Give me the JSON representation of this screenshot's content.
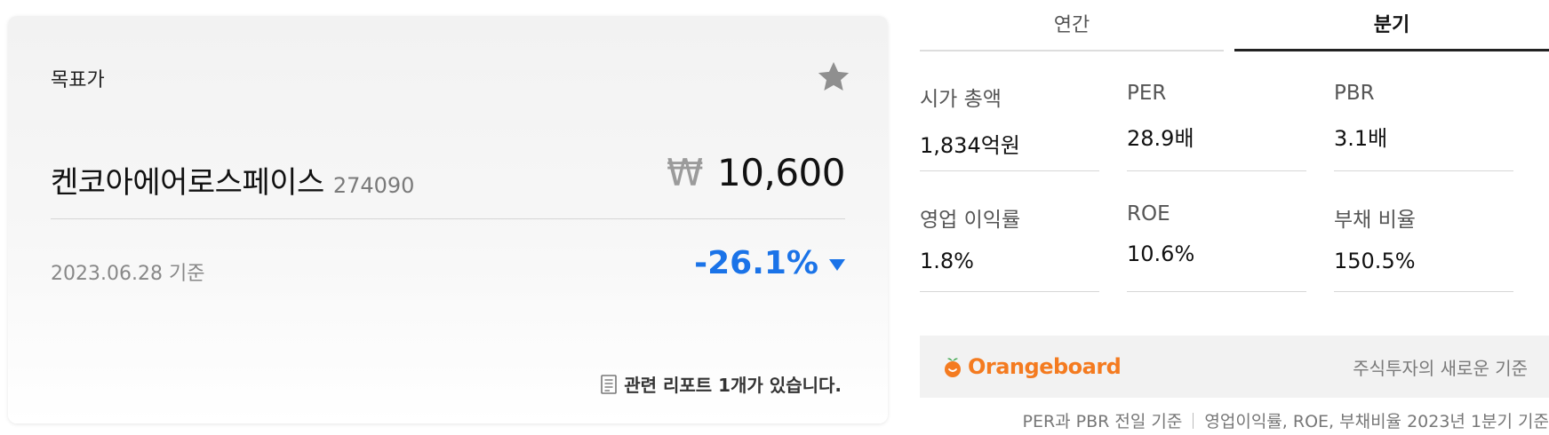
{
  "target_card": {
    "label": "목표가",
    "company_name": "켄코아에어로스페이스",
    "company_code": "274090",
    "currency_symbol": "₩",
    "target_price": "10,600",
    "as_of": "2023.06.28 기준",
    "change": "-26.1%",
    "change_color": "#1a73e8",
    "report_text": "관련 리포트 1개가 있습니다.",
    "icons": {
      "favorite": "star-icon",
      "report": "document-icon",
      "change": "down-triangle-icon"
    }
  },
  "tabs": [
    {
      "label": "연간",
      "selected": false
    },
    {
      "label": "분기",
      "selected": true
    }
  ],
  "metrics": [
    {
      "label": "시가 총액",
      "value": "1,834억원"
    },
    {
      "label": "PER",
      "value": "28.9배"
    },
    {
      "label": "PBR",
      "value": "3.1배"
    },
    {
      "label": "영업 이익률",
      "value": "1.8%"
    },
    {
      "label": "ROE",
      "value": "10.6%"
    },
    {
      "label": "부채 비율",
      "value": "150.5%"
    }
  ],
  "banner": {
    "brand": "Orangeboard",
    "brand_color": "#f47b20",
    "tagline": "주식투자의 새로운 기준",
    "icon": "orange-fruit-icon"
  },
  "footnote": {
    "part1": "PER과 PBR 전일 기준",
    "part2": "영업이익률, ROE, 부채비율 2023년 1분기 기준"
  }
}
